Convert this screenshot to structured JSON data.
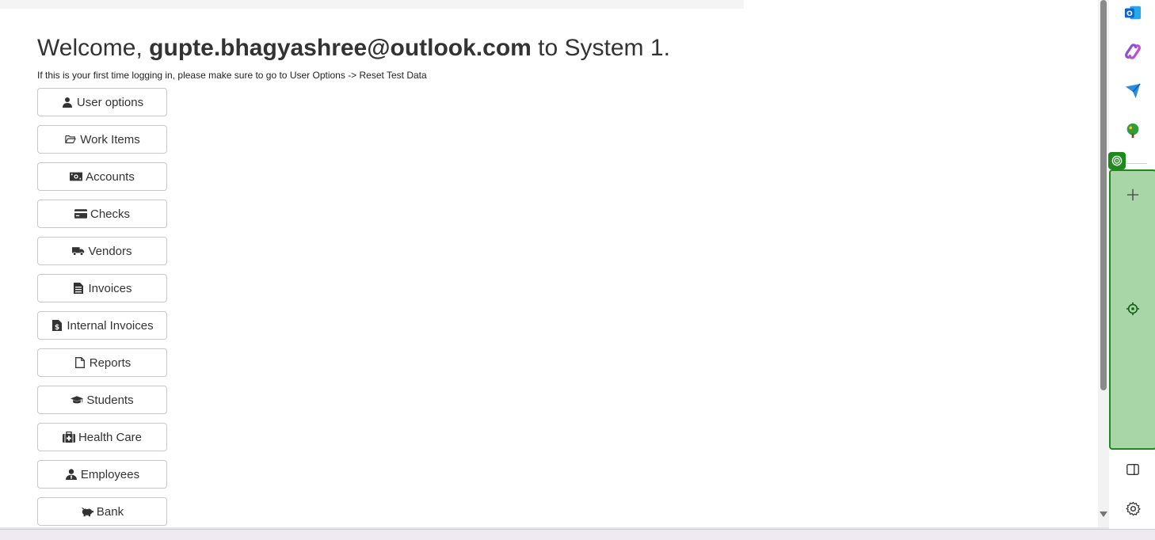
{
  "header": {
    "welcome_prefix": "Welcome,",
    "user_email": "gupte.bhagyashree@outlook.com",
    "welcome_suffix": "to System 1.",
    "hint": "If this is your first time logging in, please make sure to go to User Options -> Reset Test Data"
  },
  "menu": [
    {
      "label": "User options",
      "icon": "user-icon"
    },
    {
      "label": "Work Items",
      "icon": "folder-open-icon"
    },
    {
      "label": "Accounts",
      "icon": "money-bill-icon"
    },
    {
      "label": "Checks",
      "icon": "credit-card-icon"
    },
    {
      "label": "Vendors",
      "icon": "truck-icon"
    },
    {
      "label": "Invoices",
      "icon": "file-invoice-icon"
    },
    {
      "label": "Internal Invoices",
      "icon": "file-invoice-dollar-icon"
    },
    {
      "label": "Reports",
      "icon": "file-icon"
    },
    {
      "label": "Students",
      "icon": "graduation-cap-icon"
    },
    {
      "label": "Health Care",
      "icon": "medical-kit-icon"
    },
    {
      "label": "Employees",
      "icon": "user-tie-icon"
    },
    {
      "label": "Bank",
      "icon": "piggy-bank-icon"
    }
  ],
  "sidebar": {
    "icons": [
      "outlook-icon",
      "copilot-icon",
      "send-icon",
      "tree-icon",
      "target-icon",
      "plus-icon",
      "locate-icon",
      "panel-toggle-icon",
      "settings-icon"
    ]
  },
  "colors": {
    "accent_green": "#1e8a1e",
    "panel_green": "#a9d6a7",
    "outlook_blue": "#0a64d6"
  }
}
